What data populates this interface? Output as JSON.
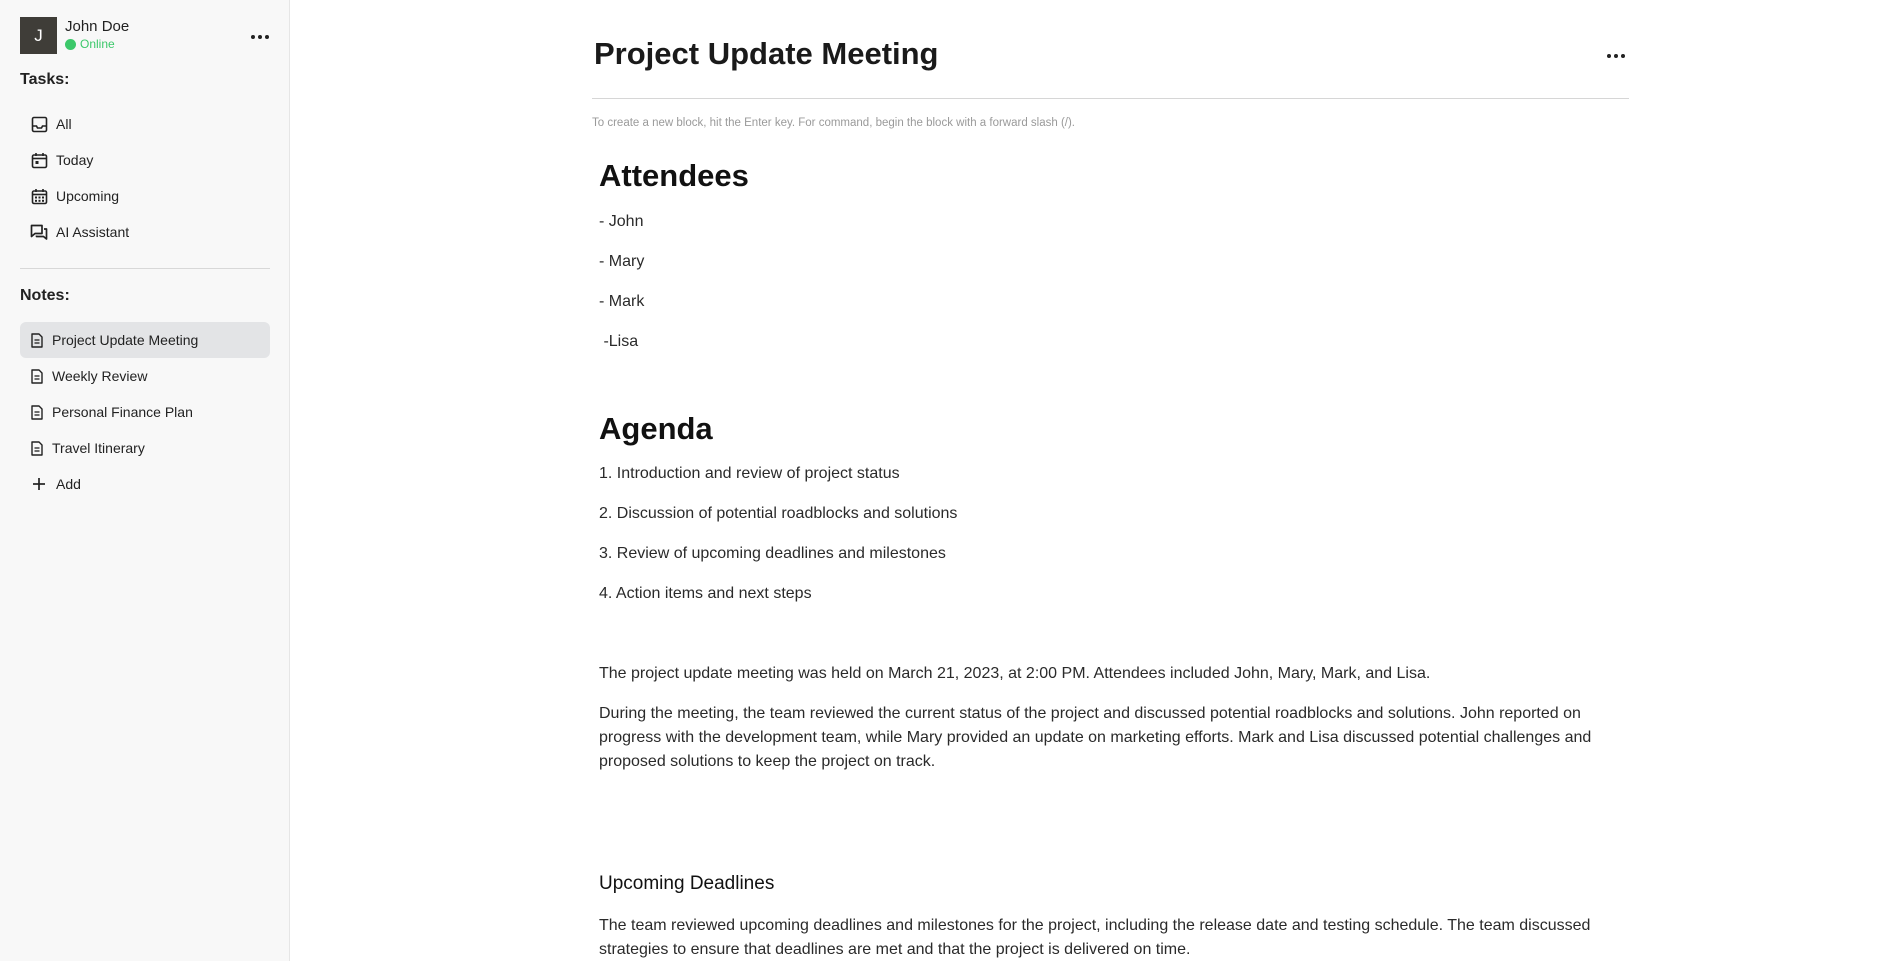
{
  "user": {
    "initial": "J",
    "name": "John Doe",
    "status": "Online"
  },
  "tasks": {
    "title": "Tasks:",
    "items": [
      {
        "label": "All",
        "icon": "inbox-icon"
      },
      {
        "label": "Today",
        "icon": "calendar-day-icon"
      },
      {
        "label": "Upcoming",
        "icon": "calendar-grid-icon"
      },
      {
        "label": "AI Assistant",
        "icon": "chat-icon"
      }
    ]
  },
  "notes": {
    "title": "Notes:",
    "items": [
      {
        "label": "Project Update Meeting",
        "active": true
      },
      {
        "label": "Weekly Review"
      },
      {
        "label": "Personal Finance Plan"
      },
      {
        "label": "Travel Itinerary"
      }
    ],
    "add_label": "Add"
  },
  "document": {
    "title": "Project Update Meeting",
    "hint": "To create a new block, hit the Enter key. For command, begin the block with a forward slash (/).",
    "attendees_heading": "Attendees",
    "attendees": [
      "- John",
      "- Mary",
      "- Mark",
      " -Lisa"
    ],
    "agenda_heading": "Agenda",
    "agenda": [
      "1. Introduction and review of project status",
      "2. Discussion of potential roadblocks and solutions",
      "3. Review of upcoming deadlines and milestones",
      "4. Action items and next steps"
    ],
    "summary": "The project update meeting was held on March 21, 2023, at 2:00 PM. Attendees included John, Mary, Mark, and Lisa.",
    "discussion": "During the meeting, the team reviewed the current status of the project and discussed potential roadblocks and solutions. John reported on progress with the development team, while Mary provided an update on marketing efforts. Mark and Lisa discussed potential challenges and proposed solutions to keep the project on track.",
    "deadlines_heading": "Upcoming Deadlines",
    "deadlines_text": "The team reviewed upcoming deadlines and milestones for the project, including the release date and testing schedule. The team discussed strategies to ensure that deadlines are met and that the project is delivered on time."
  },
  "colors": {
    "online": "#3cc86a",
    "avatar_bg": "#3f3d38",
    "active_note_bg": "#e3e4e6"
  }
}
